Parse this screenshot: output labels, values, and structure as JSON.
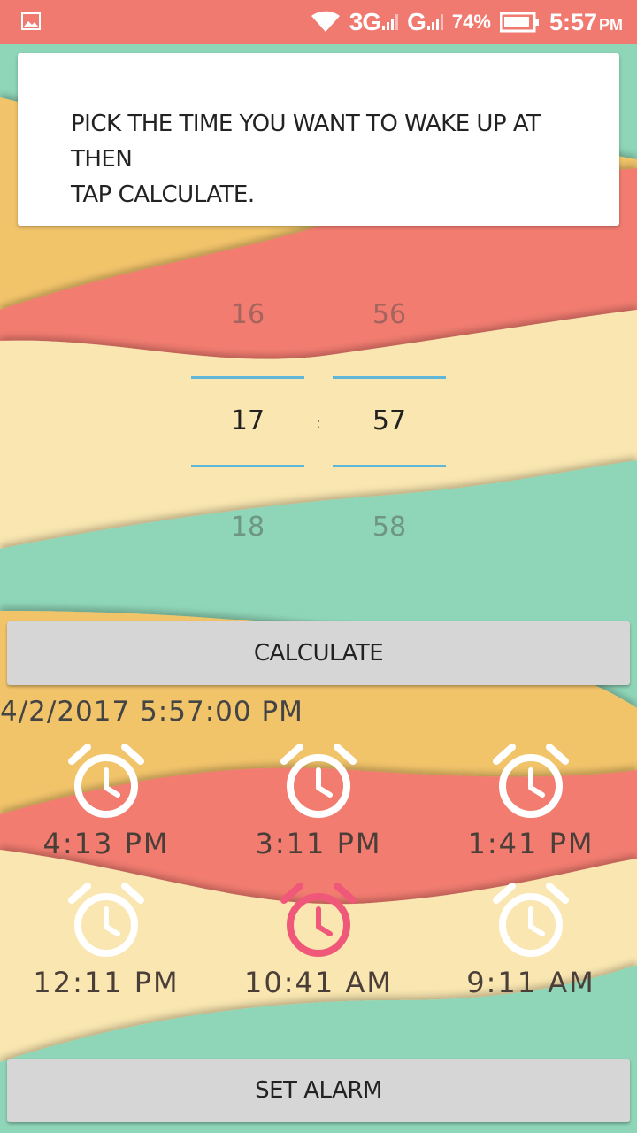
{
  "status_bar": {
    "network_label": "3G",
    "network2_label": "G",
    "battery_percent": "74%",
    "time": "5:57",
    "time_suffix": "PM",
    "icons": [
      "image-icon",
      "wifi-icon",
      "signal-icon",
      "battery-icon"
    ]
  },
  "instruction": {
    "line1": "PICK THE TIME YOU WANT TO WAKE UP AT THEN",
    "line2": "TAP CALCULATE."
  },
  "time_picker": {
    "hour": {
      "prev": "16",
      "current": "17",
      "next": "18"
    },
    "minute": {
      "prev": "56",
      "current": "57",
      "next": "58"
    },
    "separator": ":"
  },
  "calculate_button": {
    "label": "CALCULATE"
  },
  "result_datetime": "4/2/2017 5:57:00 PM",
  "alarms": [
    {
      "time": "4:13 PM",
      "highlighted": false
    },
    {
      "time": "3:11 PM",
      "highlighted": false
    },
    {
      "time": "1:41 PM",
      "highlighted": false
    },
    {
      "time": "12:11 PM",
      "highlighted": false
    },
    {
      "time": "10:41 AM",
      "highlighted": true
    },
    {
      "time": "9:11 AM",
      "highlighted": false
    }
  ],
  "set_alarm_button": {
    "label": "SET ALARM"
  },
  "colors": {
    "status_bar": "#f07a70",
    "picker_line": "#5fb6d8",
    "alarm_icon": "#ffffff",
    "alarm_icon_highlight": "#f0587a",
    "button_bg": "#d6d6d6"
  }
}
